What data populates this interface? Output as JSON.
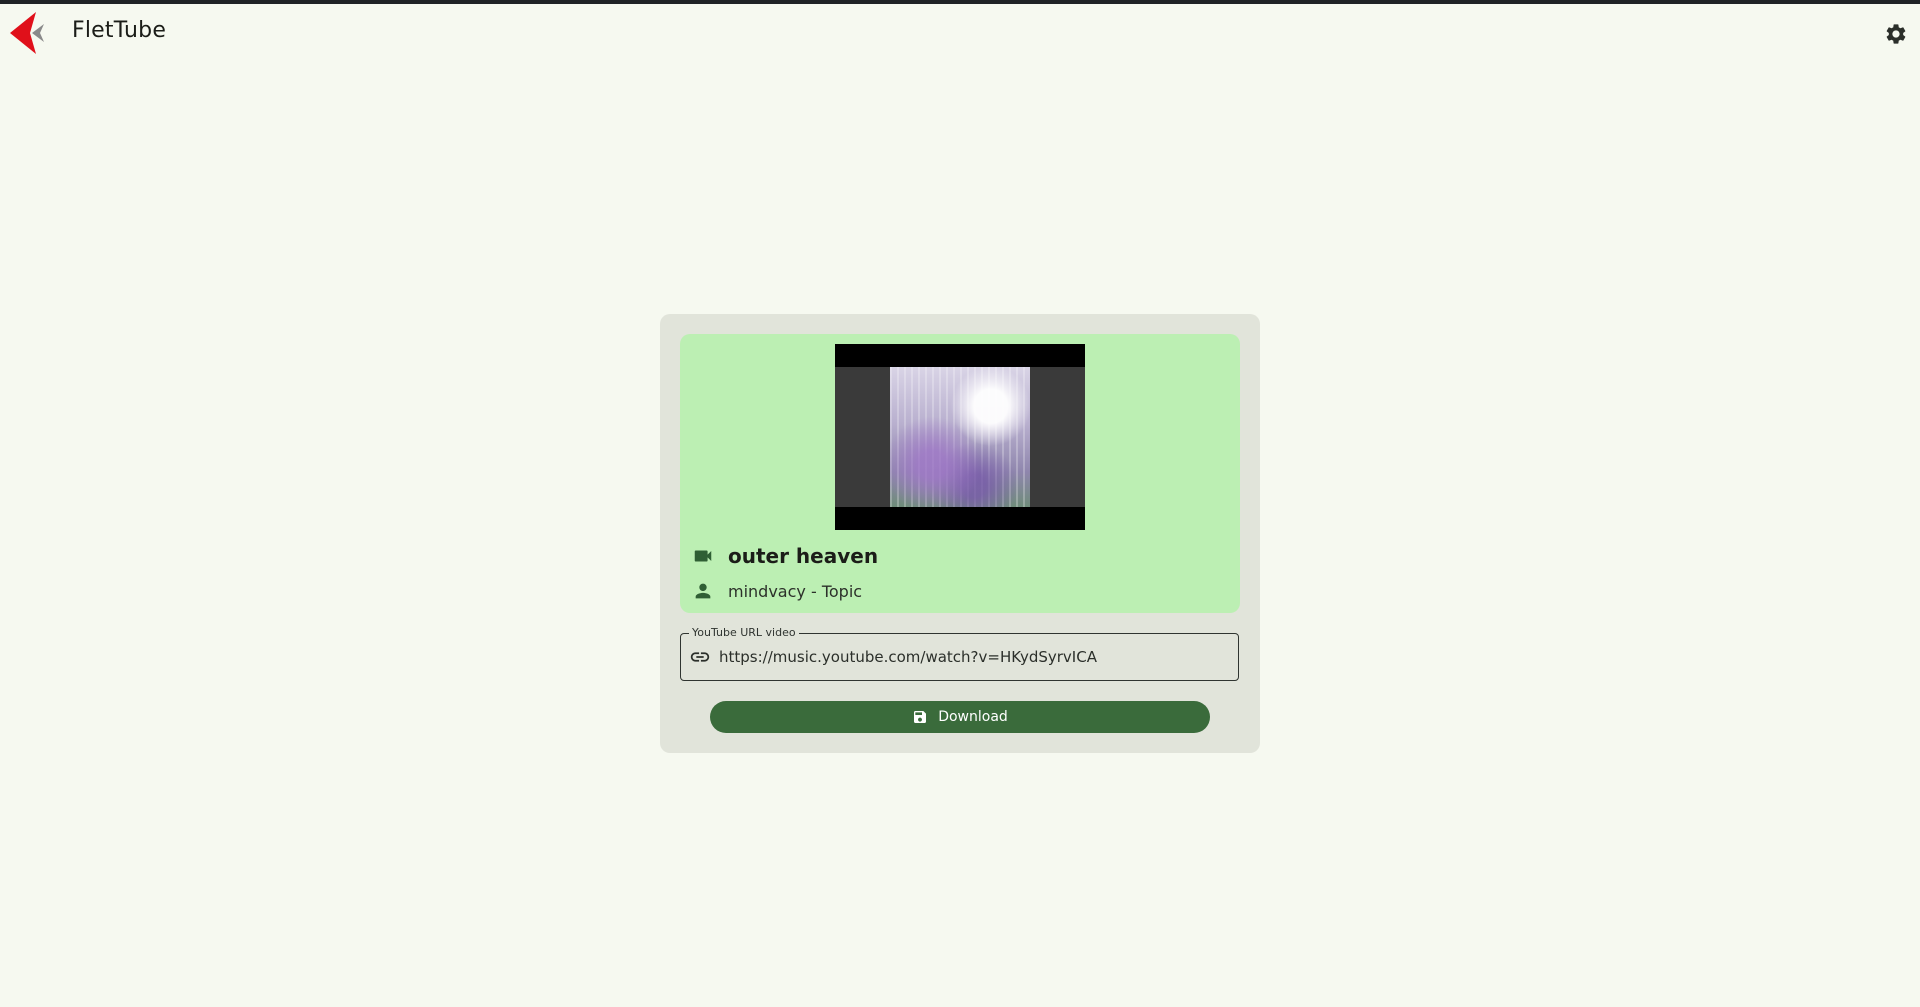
{
  "app": {
    "title": "FletTube",
    "logo": "flettube-logo",
    "settings_icon": "gear-icon"
  },
  "video": {
    "thumbnail": "video-thumbnail",
    "title_icon": "videocam-icon",
    "title": "outer heaven",
    "author_icon": "person-icon",
    "author": "mindvacy - Topic"
  },
  "url_field": {
    "label": "YouTube URL video",
    "icon": "link-icon",
    "value": "https://music.youtube.com/watch?v=HKydSyrvICA"
  },
  "download": {
    "label": "Download",
    "icon": "save-icon"
  },
  "colors": {
    "background": "#f6f9f0",
    "panel": "#e1e4da",
    "info_card": "#bcefb3",
    "primary": "#3a6b3b",
    "logo_red": "#e0101a"
  }
}
